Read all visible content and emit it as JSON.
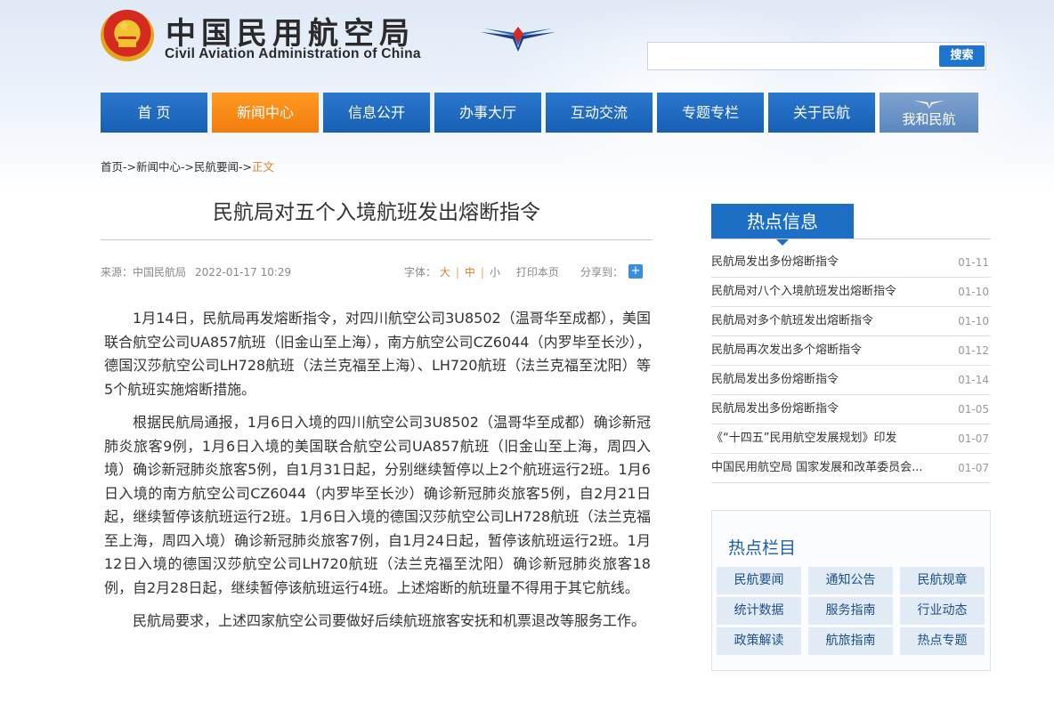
{
  "header": {
    "site_name_cn": "中国民用航空局",
    "site_name_en": "Civil Aviation Administration of China",
    "emblem_icon": "national-emblem-icon",
    "logo_icon": "caac-wings-logo-icon",
    "search_placeholder": "",
    "search_button": "搜索"
  },
  "nav": {
    "items": [
      {
        "label": "首 页"
      },
      {
        "label": "新闻中心",
        "active": true
      },
      {
        "label": "信息公开"
      },
      {
        "label": "办事大厅"
      },
      {
        "label": "互动交流"
      },
      {
        "label": "专题专栏"
      },
      {
        "label": "关于民航"
      },
      {
        "label": "我和民航"
      }
    ]
  },
  "breadcrumb": {
    "home": "首页",
    "sep": "->",
    "news": "新闻中心",
    "section": "民航要闻",
    "current": "正文"
  },
  "article": {
    "title": "民航局对五个入境航班发出熔断指令",
    "source": "来源：中国民航局",
    "date": "2022-01-17 10:29",
    "font_label": "字体：",
    "font_large": "大",
    "font_medium": "中",
    "font_small": "小",
    "print": "打印本页",
    "share_label": "分享到：",
    "share_icon": "+",
    "paragraphs": [
      "1月14日，民航局再发熔断指令，对四川航空公司3U8502（温哥华至成都），美国联合航空公司UA857航班（旧金山至上海），南方航空公司CZ6044（内罗毕至长沙），德国汉莎航空公司LH728航班（法兰克福至上海）、LH720航班（法兰克福至沈阳）等5个航班实施熔断措施。",
      "根据民航局通报，1月6日入境的四川航空公司3U8502（温哥华至成都）确诊新冠肺炎旅客9例，1月6日入境的美国联合航空公司UA857航班（旧金山至上海，周四入境）确诊新冠肺炎旅客5例，自1月31日起，分别继续暂停以上2个航班运行2班。1月6日入境的南方航空公司CZ6044（内罗毕至长沙）确诊新冠肺炎旅客5例，自2月21日起，继续暂停该航班运行2班。1月6日入境的德国汉莎航空公司LH728航班（法兰克福至上海，周四入境）确诊新冠肺炎旅客7例，自1月24日起，暂停该航班运行2班。1月12日入境的德国汉莎航空公司LH720航班（法兰克福至沈阳）确诊新冠肺炎旅客18例，自2月28日起，继续暂停该航班运行4班。上述熔断的航班量不得用于其它航线。",
      "民航局要求，上述四家航空公司要做好后续航班旅客安抚和机票退改等服务工作。"
    ]
  },
  "hot_info": {
    "title": "热点信息",
    "items": [
      {
        "title": "民航局发出多份熔断指令",
        "date": "01-11"
      },
      {
        "title": "民航局对八个入境航班发出熔断指令",
        "date": "01-10"
      },
      {
        "title": "民航局对多个航班发出熔断指令",
        "date": "01-10"
      },
      {
        "title": "民航局再次发出多个熔断指令",
        "date": "01-12"
      },
      {
        "title": "民航局发出多份熔断指令",
        "date": "01-14"
      },
      {
        "title": "民航局发出多份熔断指令",
        "date": "01-05"
      },
      {
        "title": "《“十四五”民用航空发展规划》印发",
        "date": "01-07"
      },
      {
        "title": "中国民用航空局 国家发展和改革委员会...",
        "date": "01-07"
      }
    ]
  },
  "hot_columns": {
    "title": "热点栏目",
    "items": [
      "民航要闻",
      "通知公告",
      "民航规章",
      "统计数据",
      "服务指南",
      "行业动态",
      "政策解读",
      "航旅指南",
      "热点专题"
    ]
  },
  "colors": {
    "nav_blue": "#1d6ec5",
    "nav_active": "#f58a14",
    "accent_orange": "#e67e22"
  }
}
